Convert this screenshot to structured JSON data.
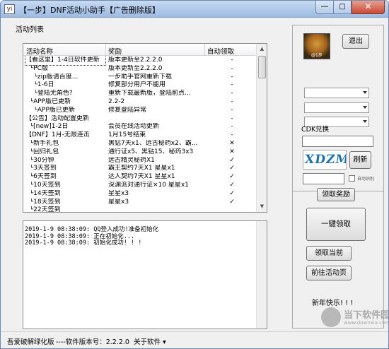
{
  "window": {
    "title": "【一步】DNF活动小助手【广告删除版】",
    "app_icon": "yi",
    "min_label": "—",
    "max_label": "□",
    "close_label": "✕"
  },
  "activity_section": {
    "label": "活动列表"
  },
  "list": {
    "columns": [
      "活动名称",
      "奖励",
      "自动领取"
    ],
    "rows": [
      {
        "name": "【看这里】1-4日软件更新",
        "reward": "版本更新至2.2.2.0",
        "auto": "-"
      },
      {
        "name": "  └PC版",
        "reward": "版本更新至2.2.2.0",
        "auto": "-"
      },
      {
        "name": "    └zip版请百度...",
        "reward": "一步助手官网重新下载",
        "auto": "-"
      },
      {
        "name": "    └1-6日",
        "reward": "修复部分用户不能用",
        "auto": "-"
      },
      {
        "name": "    └登陆无角色?",
        "reward": "重新下载最新版，登陆前点...",
        "auto": "-"
      },
      {
        "name": "  └APP版已更新",
        "reward": "2.2-2",
        "auto": "-"
      },
      {
        "name": "    └APP版已更新",
        "reward": "修复登陆异常",
        "auto": "-"
      },
      {
        "name": "【公告】活动配置更新",
        "reward": "",
        "auto": "-"
      },
      {
        "name": "  └[new]1-2日",
        "reward": "会员在线活动更新",
        "auto": "-"
      },
      {
        "name": "【DNF】1月-无限连击",
        "reward": "1月15号结束",
        "auto": "-"
      },
      {
        "name": "  └新手礼包",
        "reward": "黑钻7天x1、远古秘药x2、霸...",
        "auto": "✕"
      },
      {
        "name": "  └回归礼包",
        "reward": "通行证x5、黑钻15、秘药3x3",
        "auto": "✕"
      },
      {
        "name": "  └30分钟",
        "reward": "远古精灵秘药X1",
        "auto": "✓"
      },
      {
        "name": "  └3天签到",
        "reward": "霸王契约7天X1 星星x1",
        "auto": "✓"
      },
      {
        "name": "  └6天签到",
        "reward": "达人契约7天X1 星星x1",
        "auto": "✓"
      },
      {
        "name": "  └10天签到",
        "reward": "深渊派对通行证×10 星星x1",
        "auto": "✓"
      },
      {
        "name": "  └14天签到",
        "reward": "星星x3",
        "auto": "✓"
      },
      {
        "name": "  └18天签到",
        "reward": "星星x3",
        "auto": "✓"
      },
      {
        "name": "  └22天签到",
        "reward": "",
        "auto": ""
      }
    ]
  },
  "log": {
    "lines": [
      "2019-1-9 08:38:09: QQ登入成功!准备初始化",
      "2019-1-9 08:38:09: 正在初始化...",
      "2019-1-9 08:38:09: 初始化成功! ! !"
    ]
  },
  "right_panel": {
    "avatar_caption": "@1步",
    "exit_label": "退出",
    "cdk_label": "CDK兑换",
    "cdk_value": "",
    "captcha_text": "XDZM",
    "refresh_label": "刷新",
    "code_value": "",
    "auto_identify_label": "自动识别",
    "claim_reward_label": "领取奖励",
    "one_key_label": "一键领取",
    "claim_current_label": "领取当前",
    "goto_activity_label": "前往活动页",
    "greeting": "新年快乐! ! !"
  },
  "statusbar": {
    "left_text": "吾爱破解绿化版",
    "version_text": "----软件版本号：2.2.2.0",
    "about_label": "关于软件 ▾"
  },
  "watermark": {
    "main": "当下软件园",
    "sub": "www.downxia.com"
  },
  "colors": {
    "title_bar": "#9dbbe3",
    "close_button": "#c84a35",
    "panel_bg": "#f0f0f0"
  }
}
